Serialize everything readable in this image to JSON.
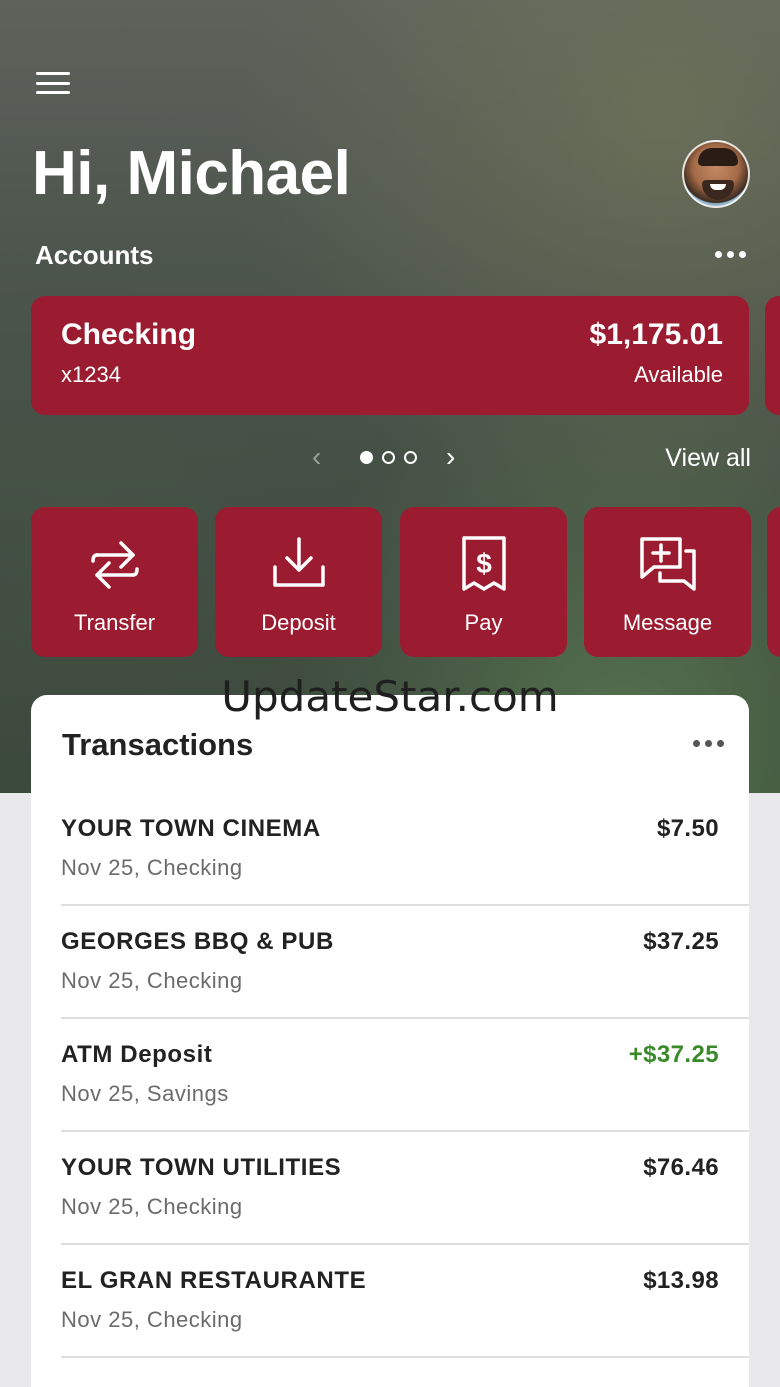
{
  "header": {
    "greeting": "Hi, Michael",
    "accounts_label": "Accounts"
  },
  "account": {
    "name": "Checking",
    "number": "x1234",
    "balance": "$1,175.01",
    "balance_label": "Available"
  },
  "carousel": {
    "total_pages": 3,
    "current_page": 1,
    "view_all": "View all"
  },
  "actions": [
    {
      "label": "Transfer",
      "icon": "transfer-icon"
    },
    {
      "label": "Deposit",
      "icon": "deposit-icon"
    },
    {
      "label": "Pay",
      "icon": "pay-bill-icon"
    },
    {
      "label": "Message",
      "icon": "message-icon"
    }
  ],
  "watermark": "UpdateStar.com",
  "transactions": {
    "title": "Transactions",
    "items": [
      {
        "payee": "YOUR TOWN CINEMA",
        "meta": "Nov 25, Checking",
        "amount": "$7.50",
        "credit": false
      },
      {
        "payee": "GEORGES BBQ & PUB",
        "meta": "Nov 25, Checking",
        "amount": "$37.25",
        "credit": false
      },
      {
        "payee": "ATM Deposit",
        "meta": "Nov 25, Savings",
        "amount": "+$37.25",
        "credit": true
      },
      {
        "payee": "YOUR TOWN UTILITIES",
        "meta": "Nov 25, Checking",
        "amount": "$76.46",
        "credit": false
      },
      {
        "payee": "EL GRAN RESTAURANTE",
        "meta": "Nov 25, Checking",
        "amount": "$13.98",
        "credit": false
      }
    ]
  },
  "colors": {
    "brand": "#9b1b30",
    "credit": "#3a8a2a"
  }
}
